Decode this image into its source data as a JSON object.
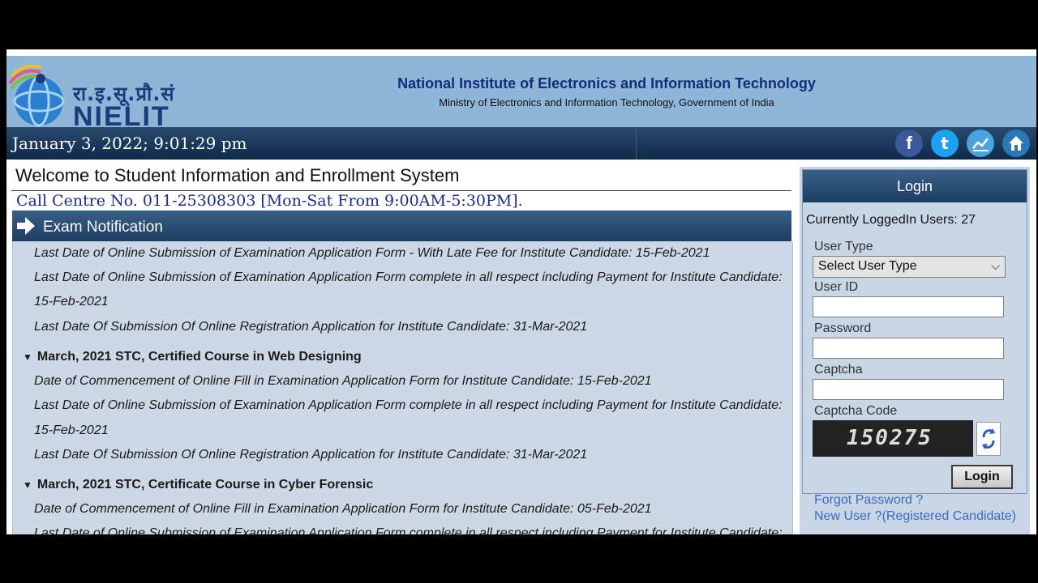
{
  "header": {
    "logo_hindi": "रा.इ.सू.प्रौ.सं",
    "logo_text": "NIELIT",
    "title": "National Institute of Electronics and Information Technology",
    "subtitle": "Ministry of Electronics and Information Technology, Government of India"
  },
  "datebar": {
    "datetime": "January 3, 2022; 9:01:29 pm",
    "icons": [
      "facebook-icon",
      "twitter-icon",
      "chart-icon",
      "home-icon"
    ]
  },
  "main": {
    "welcome": "Welcome to Student Information and Enrollment System",
    "call_centre": "Call Centre No. 011-25308303 [Mon-Sat From 9:00AM-5:30PM].",
    "exam_title": "Exam Notification",
    "lines": [
      "Last Date of Online Submission of Examination Application Form - With Late Fee for Institute Candidate: 15-Feb-2021",
      "Last Date of Online Submission of Examination Application Form complete in all respect including Payment for Institute Candidate:",
      "15-Feb-2021",
      "Last Date Of Submission Of Online Registration Application for Institute Candidate: 31-Mar-2021",
      "March, 2021 STC, Certified Course in Web Designing",
      "Date of Commencement of Online Fill in Examination Application Form for Institute Candidate: 15-Feb-2021",
      "Last Date of Online Submission of Examination Application Form complete in all respect including Payment for Institute Candidate:",
      "15-Feb-2021",
      "Last Date Of Submission Of Online Registration Application for Institute Candidate: 31-Mar-2021",
      "March, 2021 STC, Certificate Course in Cyber Forensic",
      "Date of Commencement of Online Fill in Examination Application Form for Institute Candidate: 05-Feb-2021",
      "Last Date of Online Submission of Examination Application Form complete in all respect including Payment for Institute Candidate:"
    ]
  },
  "login": {
    "heading": "Login",
    "logged_in": "Currently LoggedIn Users: 27",
    "user_type_label": "User Type",
    "user_type_value": "Select User Type",
    "user_id_label": "User ID",
    "password_label": "Password",
    "captcha_label": "Captcha",
    "captcha_code_label": "Captcha Code",
    "captcha_code": "150275",
    "button": "Login",
    "forgot": "Forgot Password ?",
    "new_user": "New User ?(Registered Candidate)"
  },
  "colors": {
    "header_bg": "#8fb5d9",
    "bar_dark": "#1e3d63",
    "panel_bg": "#ccd8e6",
    "link": "#3a6bbf"
  }
}
